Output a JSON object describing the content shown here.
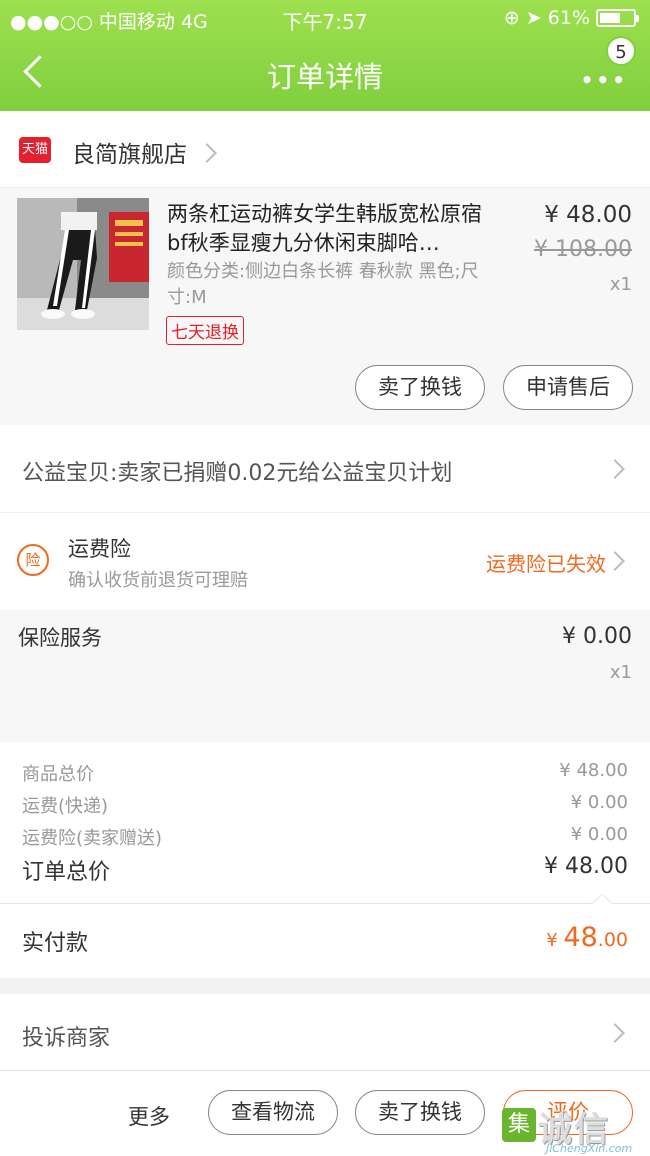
{
  "status_bar": {
    "carrier": "●●●○○ 中国移动   4G",
    "time": "下午7:57",
    "battery": "61%",
    "battery_level": 0.61
  },
  "header": {
    "title": "订单详情",
    "more": "•••",
    "badge": "5"
  },
  "shop": {
    "badge": "天猫",
    "name": "良简旗舰店"
  },
  "goods": {
    "title": "两条杠运动裤女学生韩版宽松原宿bf秋季显瘦九分休闲束脚哈…",
    "sku": "颜色分类:侧边白条长裤 春秋款 黑色;尺寸:M",
    "tag": "七天退换",
    "price": "¥ 48.00",
    "price_original": "¥ 108.00",
    "quantity": "x1",
    "buttons": [
      "卖了换钱",
      "申请售后"
    ]
  },
  "charity": {
    "text": "公益宝贝:卖家已捐赠0.02元给公益宝贝计划"
  },
  "insurance": {
    "icon": "险",
    "title": "运费险",
    "subtitle": "确认收货前退货可理赔",
    "status": "运费险已失效"
  },
  "service": {
    "name": "保险服务",
    "price": "¥ 0.00",
    "quantity": "x1"
  },
  "summary": {
    "rows": [
      {
        "label": "商品总价",
        "value": "¥ 48.00"
      },
      {
        "label": "运费(快递)",
        "value": "¥ 0.00"
      },
      {
        "label": "运费险(卖家赠送)",
        "value": "¥ 0.00"
      }
    ],
    "total_label": "订单总价",
    "total_value": "¥ 48.00"
  },
  "payment": {
    "label": "实付款",
    "currency": "¥ ",
    "amount_int": "48",
    "amount_dec": ".00"
  },
  "complain": {
    "text": "投诉商家"
  },
  "bottom_bar": {
    "more": "更多",
    "buttons": [
      "查看物流",
      "卖了换钱",
      "评价"
    ]
  },
  "watermark": {
    "logo": "集",
    "text": "诚信",
    "url": "JiChengXin.com"
  },
  "colors": {
    "header_green": "#8ad646",
    "accent_orange": "#ef6a1f",
    "tmall_red": "#e2202e"
  }
}
